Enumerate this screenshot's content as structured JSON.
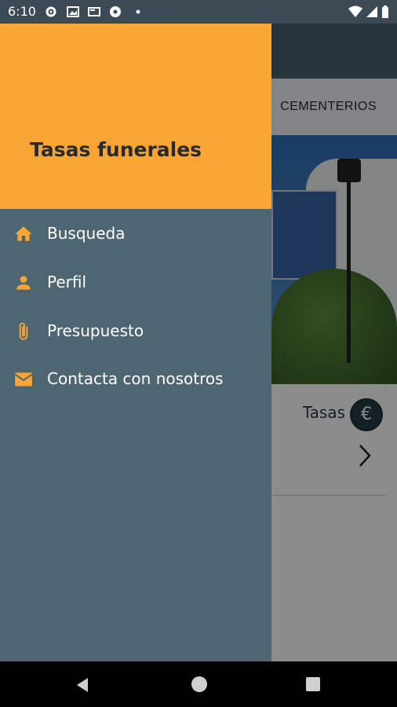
{
  "status_bar": {
    "time": "6:10",
    "left_icons": [
      "settings-icon",
      "photo-icon",
      "screen-icon",
      "sports-icon",
      "dot-icon"
    ],
    "right_icons": [
      "wifi-icon",
      "signal-icon",
      "battery-icon"
    ]
  },
  "background": {
    "tab_label": "CEMENTERIOS",
    "tasas_label": "Tasas",
    "euro_symbol": "€",
    "scrim_color": "#00000073"
  },
  "drawer": {
    "title": "Tasas funerales",
    "header_color": "#f9a533",
    "background_color": "#4e6572",
    "icon_color": "#f9a533",
    "items": [
      {
        "label": "Busqueda",
        "icon": "home-icon"
      },
      {
        "label": "Perfil",
        "icon": "person-icon"
      },
      {
        "label": "Presupuesto",
        "icon": "paperclip-icon"
      },
      {
        "label": "Contacta con nosotros",
        "icon": "email-icon"
      }
    ]
  },
  "nav_bar": {
    "icons": [
      "back-icon",
      "home-circle-icon",
      "recents-icon"
    ]
  }
}
